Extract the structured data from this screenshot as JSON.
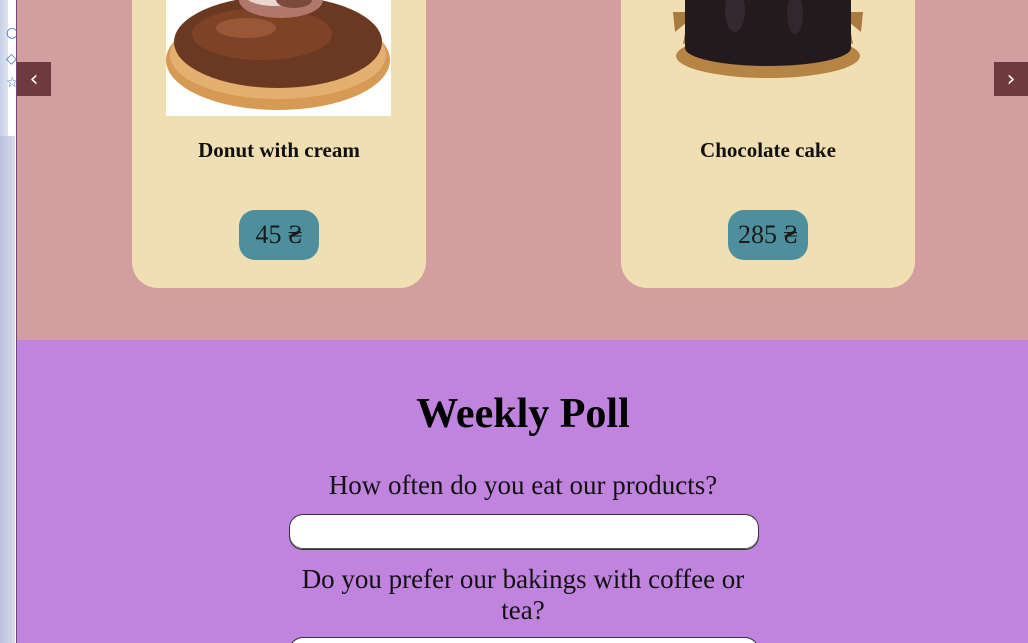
{
  "carousel": {
    "prev_label": "‹",
    "next_label": "›",
    "products": [
      {
        "name": "Donut with cream",
        "price": "45 ₴"
      },
      {
        "name": "Chocolate cake",
        "price": "285 ₴"
      }
    ]
  },
  "poll": {
    "title": "Weekly Poll",
    "questions": [
      {
        "text": "How often do you eat our products?",
        "answer_value": ""
      },
      {
        "text": "Do you prefer our bakings with coffee or tea?",
        "answer_value": ""
      }
    ]
  },
  "colors": {
    "products_bg": "#d29e9f",
    "card_bg": "#f1dfb4",
    "price_bg": "#4e8f9e",
    "nav_bg": "#6e3a3d",
    "poll_bg": "#c084df"
  }
}
